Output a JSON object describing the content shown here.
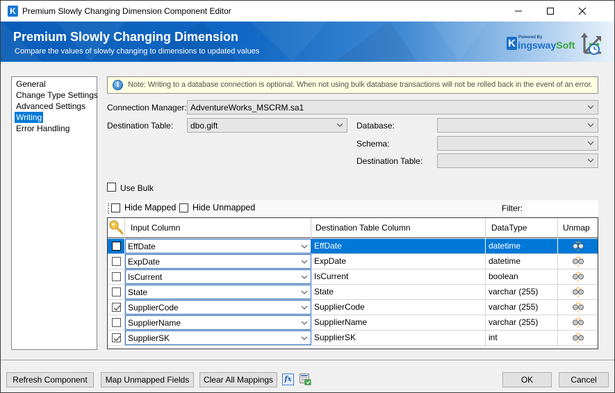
{
  "window": {
    "title": "Premium Slowly Changing Dimension Component Editor",
    "icon": "kingswaysoft-k-icon",
    "controls": {
      "minimize": "minimize-icon",
      "maximize": "maximize-icon",
      "close": "close-icon"
    }
  },
  "banner": {
    "title": "Premium Slowly Changing Dimension",
    "subtitle": "Compare the values of slowly changing to dimensions to updated values",
    "logo_powered_by": "Powered By",
    "logo_k": "K",
    "logo_name_part1": "ingsway",
    "logo_name_part2": "Soft",
    "component_icon": "scd-component-icon"
  },
  "nav": {
    "items": [
      {
        "label": "General",
        "selected": false
      },
      {
        "label": "Change Type Settings",
        "selected": false
      },
      {
        "label": "Advanced Settings",
        "selected": false
      },
      {
        "label": "Writing",
        "selected": true
      },
      {
        "label": "Error Handling",
        "selected": false
      }
    ]
  },
  "note": {
    "icon": "info-icon",
    "text": "Note: Writing to a database connection is optional. When not using bulk database transactions will not be rolled back in the event of an error."
  },
  "form": {
    "connection_manager_label": "Connection Manager:",
    "connection_manager_value": "AdventureWorks_MSCRM.sa1",
    "destination_table_label": "Destination Table:",
    "destination_table_value": "dbo.gift",
    "database_label": "Database:",
    "database_value": "",
    "schema_label": "Schema:",
    "schema_value": "",
    "bulk_destination_table_label": "Destination Table:",
    "bulk_destination_table_value": "",
    "use_bulk_label": "Use Bulk",
    "use_bulk_checked": false
  },
  "toolbar": {
    "hide_mapped_label": "Hide Mapped",
    "hide_mapped_checked": false,
    "hide_unmapped_label": "Hide Unmapped",
    "hide_unmapped_checked": false,
    "filter_label": "Filter:",
    "filter_value": ""
  },
  "grid": {
    "columns": {
      "key": "key-icon",
      "input": "Input Column",
      "destination": "Destination Table Column",
      "datatype": "DataType",
      "unmap": "Unmap"
    },
    "rows": [
      {
        "key": false,
        "input": "EffDate",
        "destination": "EffDate",
        "datatype": "datetime",
        "selected": true
      },
      {
        "key": false,
        "input": "ExpDate",
        "destination": "ExpDate",
        "datatype": "datetime",
        "selected": false
      },
      {
        "key": false,
        "input": "IsCurrent",
        "destination": "IsCurrent",
        "datatype": "boolean",
        "selected": false
      },
      {
        "key": false,
        "input": "State",
        "destination": "State",
        "datatype": "varchar (255)",
        "selected": false
      },
      {
        "key": true,
        "input": "SupplierCode",
        "destination": "SupplierCode",
        "datatype": "varchar (255)",
        "selected": false
      },
      {
        "key": false,
        "input": "SupplierName",
        "destination": "SupplierName",
        "datatype": "varchar (255)",
        "selected": false
      },
      {
        "key": true,
        "input": "SupplierSK",
        "destination": "SupplierSK",
        "datatype": "int",
        "selected": false
      }
    ]
  },
  "footer": {
    "refresh_label": "Refresh Component",
    "map_unmapped_label": "Map Unmapped Fields",
    "clear_mappings_label": "Clear All Mappings",
    "fx_icon_label": "fx",
    "ok_label": "OK",
    "cancel_label": "Cancel"
  },
  "colors": {
    "selection": "#0078d7",
    "banner": "#0a5db8",
    "note_bg": "#ffffe1"
  }
}
